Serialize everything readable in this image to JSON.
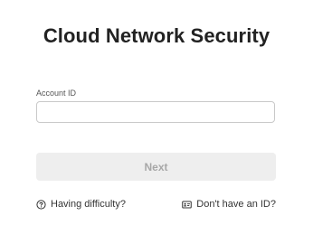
{
  "page": {
    "title": "Cloud Network Security"
  },
  "form": {
    "account_id_label": "Account ID",
    "account_id_value": "",
    "account_id_placeholder": "",
    "next_label": "Next"
  },
  "links": {
    "help": {
      "label": "Having difficulty?",
      "icon": "help-circle-icon"
    },
    "signup": {
      "label": "Don't have an ID?",
      "icon": "id-card-icon"
    }
  },
  "colors": {
    "button_background": "#eeeeee",
    "button_text": "#a7a7a7",
    "input_border": "#c9c9c9"
  }
}
